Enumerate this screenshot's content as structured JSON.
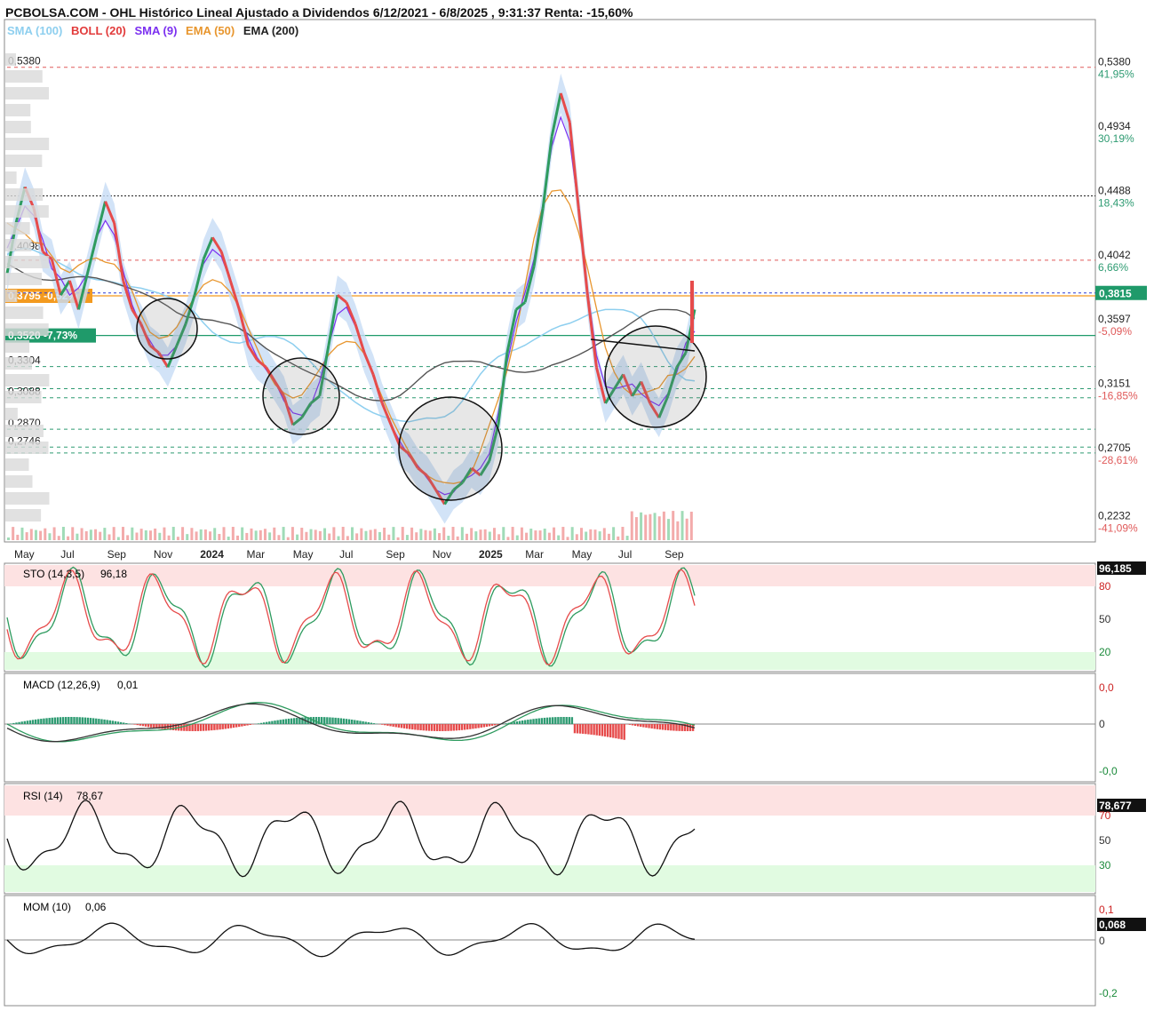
{
  "page": {
    "title": "PCBOLSA.COM - OHL Histórico Lineal Ajustado a Dividendos 6/12/2021 - 6/8/2025 , 9:31:37 Renta: -15,60%"
  },
  "legend": [
    {
      "label": "SMA (100)",
      "color": "#8ecfef"
    },
    {
      "label": "BOLL (20)",
      "color": "#e23b3b"
    },
    {
      "label": "SMA (9)",
      "color": "#7b2ff0"
    },
    {
      "label": "EMA (50)",
      "color": "#e8962e"
    },
    {
      "label": "EMA (200)",
      "color": "#222222"
    }
  ],
  "colors": {
    "up": "#2e9b5f",
    "down": "#e64b4b",
    "boll_band": "#c7dcf5",
    "grid_red": "#e05a5a",
    "grid_green": "#2e9b72",
    "last_price": "#1f9a6a",
    "orange_tag": "#f39a1f",
    "green_tag": "#1f9a6a"
  },
  "chart_data": [
    {
      "type": "line",
      "name": "price",
      "x_ticks": [
        "May",
        "Jul",
        "Sep",
        "Nov",
        "2024",
        "Mar",
        "May",
        "Jul",
        "Sep",
        "Nov",
        "2025",
        "Mar",
        "May",
        "Jul",
        "Sep"
      ],
      "ylim": [
        0.215,
        0.56
      ],
      "price_series": [
        0.395,
        0.43,
        0.455,
        0.44,
        0.41,
        0.405,
        0.38,
        0.39,
        0.37,
        0.395,
        0.42,
        0.445,
        0.43,
        0.39,
        0.37,
        0.36,
        0.345,
        0.34,
        0.33,
        0.345,
        0.36,
        0.38,
        0.405,
        0.42,
        0.41,
        0.39,
        0.37,
        0.345,
        0.335,
        0.33,
        0.32,
        0.31,
        0.29,
        0.295,
        0.305,
        0.31,
        0.345,
        0.38,
        0.375,
        0.36,
        0.34,
        0.325,
        0.305,
        0.29,
        0.275,
        0.27,
        0.26,
        0.255,
        0.245,
        0.235,
        0.245,
        0.25,
        0.26,
        0.255,
        0.265,
        0.29,
        0.34,
        0.37,
        0.375,
        0.4,
        0.44,
        0.49,
        0.52,
        0.5,
        0.44,
        0.38,
        0.33,
        0.305,
        0.315,
        0.325,
        0.31,
        0.32,
        0.305,
        0.295,
        0.31,
        0.33,
        0.34,
        0.37
      ],
      "right_axis": [
        {
          "value": "0,5380",
          "pct": "41,95%",
          "pct_color": "#2e9b72"
        },
        {
          "value": "0,4934",
          "pct": "30,19%",
          "pct_color": "#2e9b72"
        },
        {
          "value": "0,4488",
          "pct": "18,43%",
          "pct_color": "#2e9b72"
        },
        {
          "value": "0,4042",
          "pct": "6,66%",
          "pct_color": "#2e9b72"
        },
        {
          "value": "0,3597",
          "pct": "-5,09%",
          "pct_color": "#e05a5a"
        },
        {
          "value": "0,3151",
          "pct": "-16,85%",
          "pct_color": "#e05a5a"
        },
        {
          "value": "0,2705",
          "pct": "-28,61%",
          "pct_color": "#e05a5a"
        },
        {
          "value": "0,2232",
          "pct": "-41,09%",
          "pct_color": "#e05a5a"
        }
      ],
      "last_price": "0,3815",
      "left_levels": [
        {
          "value": "0,5380"
        },
        {
          "value": "0,4098"
        },
        {
          "value": "0,3795",
          "extra": "-0,52%",
          "tag": "orange"
        },
        {
          "value": "0,3520",
          "extra": "-7,73%",
          "tag": "green"
        },
        {
          "value": "0,3304"
        },
        {
          "value": "0,3088"
        },
        {
          "value": "0,2870"
        },
        {
          "value": "0,2746"
        }
      ]
    },
    {
      "type": "line",
      "name": "STO (14,3,5)",
      "label": "STO (14,3,5)",
      "value": "96,18",
      "last": "96,185",
      "levels": [
        "80",
        "50",
        "20"
      ]
    },
    {
      "type": "line",
      "name": "MACD (12,26,9)",
      "label": "MACD (12,26,9)",
      "value": "0,01",
      "levels": [
        "0,0",
        "0",
        "-0,0"
      ]
    },
    {
      "type": "line",
      "name": "RSI (14)",
      "label": "RSI (14)",
      "value": "78,67",
      "last": "78,677",
      "levels": [
        "70",
        "50",
        "30"
      ]
    },
    {
      "type": "line",
      "name": "MOM (10)",
      "label": "MOM (10)",
      "value": "0,06",
      "last": "0,068",
      "levels": [
        "0,1",
        "0",
        "-0,2"
      ]
    }
  ]
}
